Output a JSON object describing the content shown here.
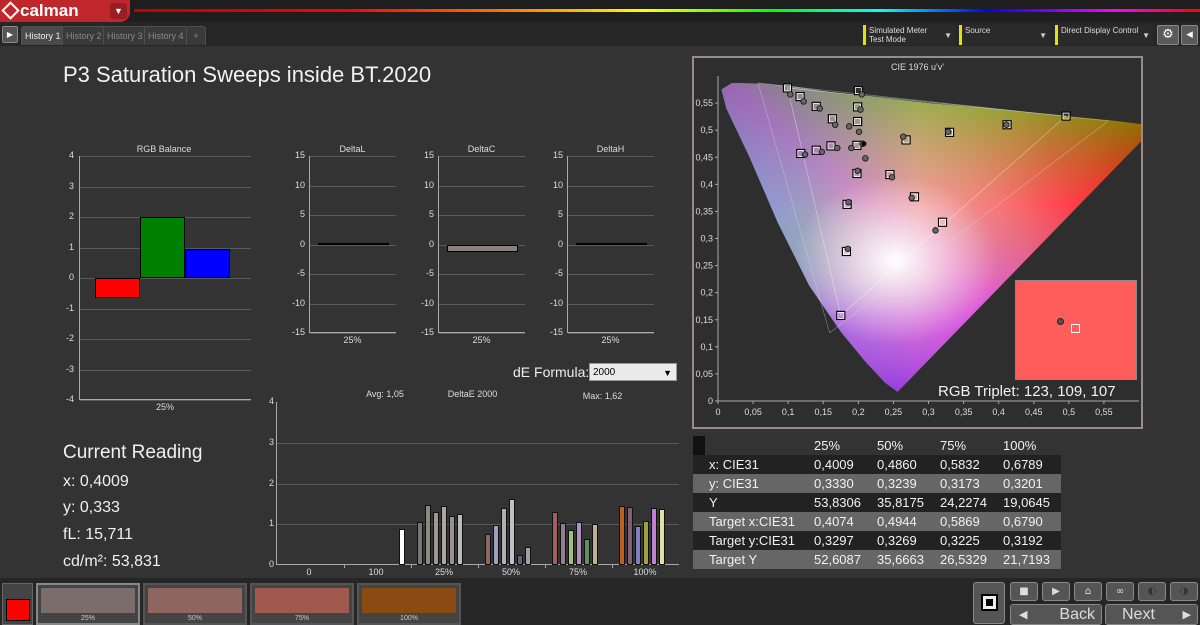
{
  "app": {
    "logo_text": "calman"
  },
  "tabs": [
    "History 1",
    "History 2",
    "History 3",
    "History 4",
    "+"
  ],
  "header_controls": [
    {
      "label": "Simulated Meter Test Mode"
    },
    {
      "label": "Source"
    },
    {
      "label": "Direct Display Control"
    }
  ],
  "page_title": "P3 Saturation Sweeps inside BT.2020",
  "rgb_balance": {
    "title": "RGB Balance",
    "xlabel": "25%",
    "y_ticks": [
      "4",
      "3",
      "2",
      "1",
      "0",
      "-1",
      "-2",
      "-3",
      "-4"
    ],
    "ylim": [
      -4,
      4
    ],
    "bars": [
      {
        "name": "R",
        "value": -0.65,
        "color": "#ff0000"
      },
      {
        "name": "G",
        "value": 2.0,
        "color": "#008000"
      },
      {
        "name": "B",
        "value": 0.95,
        "color": "#0000ff"
      }
    ]
  },
  "delta_charts": [
    {
      "title": "DeltaL",
      "xlabel": "25%",
      "value": 0.3
    },
    {
      "title": "DeltaC",
      "xlabel": "25%",
      "value": -1.2
    },
    {
      "title": "DeltaH",
      "xlabel": "25%",
      "value": 0.3
    }
  ],
  "delta_ticks": [
    "15",
    "10",
    "5",
    "0",
    "-5",
    "-10",
    "-15"
  ],
  "de_formula": {
    "label": "dE Formula:",
    "value": "2000"
  },
  "deltae": {
    "title": "DeltaE 2000",
    "avg_label": "Avg: 1,05",
    "max_label": "Max: 1,62",
    "y_ticks": [
      "4",
      "3",
      "2",
      "1",
      "0"
    ],
    "x_labels": [
      "0",
      "100",
      "25%",
      "50%",
      "75%",
      "100%"
    ]
  },
  "current_reading": {
    "title": "Current Reading",
    "x": "x: 0,4009",
    "y": "y: 0,333",
    "fl": "fL: 15,711",
    "cdm2": "cd/m²: 53,831"
  },
  "cie": {
    "title": "CIE 1976 u'v'",
    "y_ticks": [
      "0,55",
      "0,5",
      "0,45",
      "0,4",
      "0,35",
      "0,3",
      "0,25",
      "0,2",
      "0,15",
      "0,1",
      "0,05",
      "0"
    ],
    "x_ticks": [
      "0",
      "0,05",
      "0,1",
      "0,15",
      "0,2",
      "0,25",
      "0,3",
      "0,35",
      "0,4",
      "0,45",
      "0,5",
      "0,55"
    ],
    "rgb_triplet": "RGB Triplet: 123, 109, 107",
    "inset_color": "#ff5c5c"
  },
  "table": {
    "headers": [
      "",
      "25%",
      "50%",
      "75%",
      "100%"
    ],
    "rows": [
      [
        "x: CIE31",
        "0,4009",
        "0,4860",
        "0,5832",
        "0,6789"
      ],
      [
        "y: CIE31",
        "0,3330",
        "0,3239",
        "0,3173",
        "0,3201"
      ],
      [
        "Y",
        "53,8306",
        "35,8175",
        "24,2274",
        "19,0645"
      ],
      [
        "Target x:CIE31",
        "0,4074",
        "0,4944",
        "0,5869",
        "0,6790"
      ],
      [
        "Target y:CIE31",
        "0,3297",
        "0,3269",
        "0,3225",
        "0,3192"
      ],
      [
        "Target Y",
        "52,6087",
        "35,6663",
        "26,5329",
        "21,7193"
      ]
    ]
  },
  "swatches": [
    {
      "label": "25%",
      "color": "#7b6d6b"
    },
    {
      "label": "50%",
      "color": "#8f6560"
    },
    {
      "label": "75%",
      "color": "#a0594c"
    },
    {
      "label": "100%",
      "color": "#8a4a12"
    }
  ],
  "nav": {
    "back": "Back",
    "next": "Next"
  },
  "colors": {
    "accent": "#c0272d",
    "status_red": "#ff0000"
  }
}
